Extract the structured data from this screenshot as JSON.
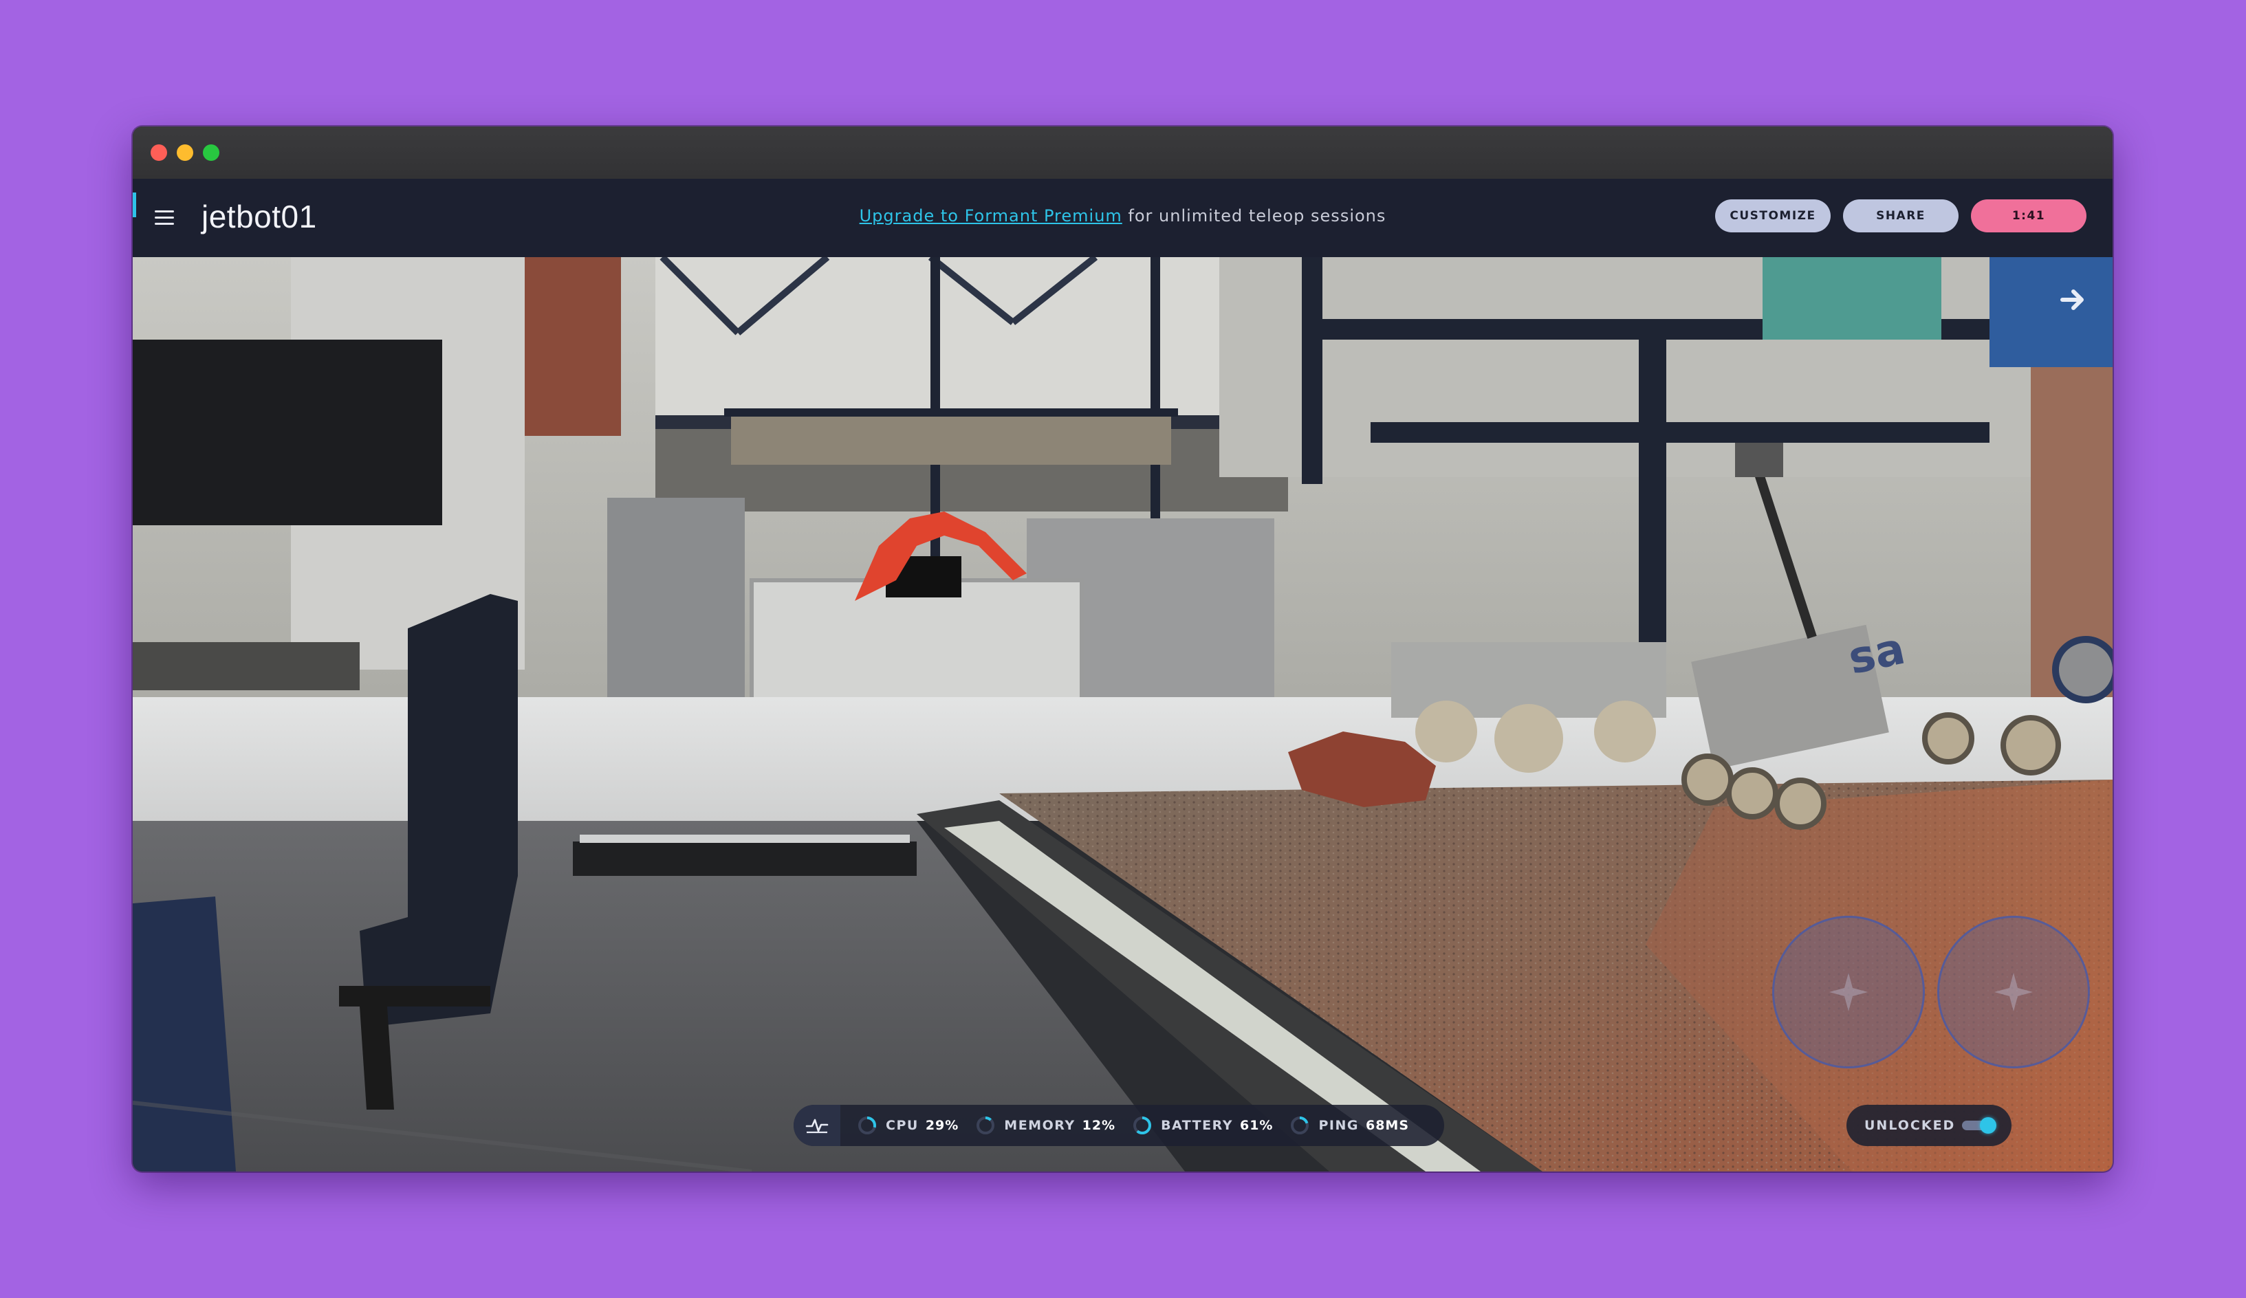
{
  "header": {
    "robot_name": "jetbot01",
    "promo_link": "Upgrade to Formant Premium",
    "promo_text": " for unlimited teleop sessions",
    "customize_label": "CUSTOMIZE",
    "share_label": "SHARE",
    "session_timer": "1:41"
  },
  "stream": {
    "view_icon": "arrow-right-icon"
  },
  "status_bar": {
    "icon": "pulse-icon",
    "metrics": [
      {
        "label": "CPU",
        "value": "29%",
        "fraction": 0.29
      },
      {
        "label": "MEMORY",
        "value": "12%",
        "fraction": 0.12
      },
      {
        "label": "BATTERY",
        "value": "61%",
        "fraction": 0.61
      },
      {
        "label": "PING",
        "value": "68MS",
        "fraction": 0.2
      }
    ]
  },
  "lock": {
    "label": "UNLOCKED",
    "enabled": true
  },
  "colors": {
    "accent": "#2ec4e8",
    "background": "#a363e3",
    "appbar": "#1c2030",
    "timer": "#f0709a",
    "button": "#bfc6e0"
  }
}
